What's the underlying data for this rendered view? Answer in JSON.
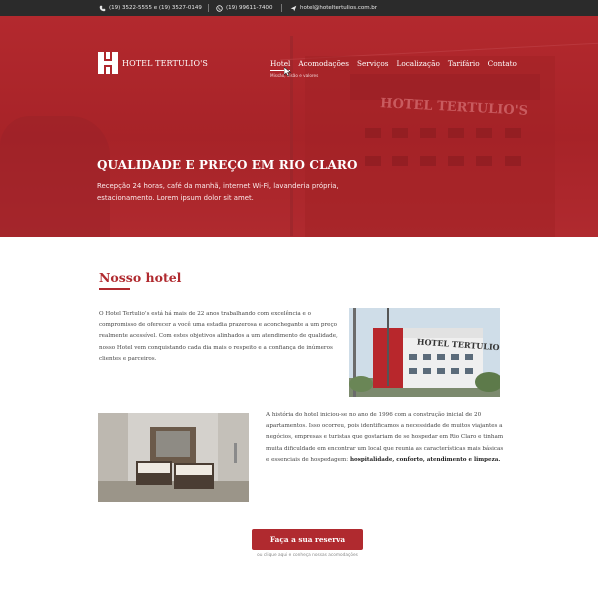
{
  "topbar": {
    "phones": "(19) 3522-5555 e (19) 3527-0149",
    "whatsapp": "(19) 99611-7400",
    "email": "hotel@hoteltertulios.com.br"
  },
  "brand": {
    "name": "HOTEL TERTULIO'S"
  },
  "nav": {
    "items": [
      "Hotel",
      "Acomodações",
      "Serviços",
      "Localização",
      "Tarifário",
      "Contato"
    ],
    "active_sub": "Missão, visão e valores"
  },
  "hero": {
    "sign": "HOTEL TERTULIO'S",
    "title": "QUALIDADE E PREÇO EM RIO CLARO",
    "description": "Recepção 24 horas, café da manhã, internet Wi-Fi, lavanderia própria, estacionamento. Lorem ipsum dolor sit amet."
  },
  "about": {
    "title": "Nosso hotel",
    "paragraph1": "O Hotel Tertulio’s está há mais de 22 anos trabalhando com excelência e o compromisso de oferecer a você uma estadia prazerosa e aconchegante a um preço realmente acessível. Com estes objetivos alinhados a um atendimento de qualidade, nosso Hotel vem conquistando cada dia mais o respeito e a confiança de inúmeros clientes e parceiros.",
    "paragraph2_text": "A história do hotel iniciou-se no ano de 1996 com a construção inicial de 20 apartamentos. Isso ocorreu, pois identificamos a necessidade de muitos viajantes a negócios, empresas e turistas que gostariam de se hospedar em Rio Claro e tinham muita dificuldade em encontrar um local que reunia as características mais básicas e essenciais de hospedagem:",
    "paragraph2_bold": "hospitalidade, conforto, atendimento e limpeza.",
    "photo1_sign": "HOTEL TERTULIO'S"
  },
  "cta": {
    "label": "Faça a sua reserva",
    "sub": "ou clique aqui e conheça nossas acomodações"
  },
  "colors": {
    "brand_red": "#b02a2f",
    "topbar": "#2b2b2b"
  }
}
